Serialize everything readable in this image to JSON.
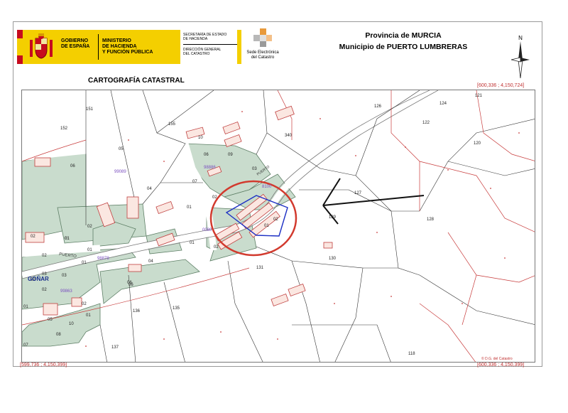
{
  "header": {
    "gobierno_line1": "GOBIERNO",
    "gobierno_line2": "DE ESPAÑA",
    "ministerio_line1": "MINISTERIO",
    "ministerio_line2": "DE HACIENDA",
    "ministerio_line3": "Y FUNCIÓN PÚBLICA",
    "secretaria_line1": "SECRETARÍA DE ESTADO",
    "secretaria_line2": "DE HACIENDA",
    "direccion_line1": "DIRECCIÓN GENERAL",
    "direccion_line2": "DEL CATASTRO",
    "sede_line1": "Sede Electrónica",
    "sede_line2": "del Catastro",
    "provincia": "Provincia de MURCIA",
    "municipio": "Municipio de PUERTO LUMBRERAS",
    "north_label": "N"
  },
  "map": {
    "title": "CARTOGRAFÍA CATASTRAL",
    "coord_top_right": "[600,336 ; 4,150,724]",
    "coord_bottom_left": "[599,736 ; 4,150,399]",
    "coord_bottom_right": "[600,336 ; 4,150,399]",
    "copyright": "© D.G. del Catastro",
    "place_name": "GOÑAR",
    "street_labels": [
      "PUERTO",
      "PUERTO"
    ],
    "block_codes": [
      "99089",
      "98886",
      "99863",
      "98878",
      "0080",
      "8100"
    ],
    "parcels": [
      "151",
      "152",
      "155",
      "05",
      "10",
      "06",
      "09",
      "340",
      "126",
      "124",
      "122",
      "121",
      "120",
      "06",
      "04",
      "07",
      "03",
      "02",
      "01",
      "02",
      "01",
      "127",
      "128",
      "129",
      "02",
      "01",
      "02",
      "01",
      "01",
      "03",
      "02",
      "04",
      "06",
      "130",
      "131",
      "136",
      "135",
      "137",
      "118",
      "02",
      "01",
      "05",
      "10",
      "08",
      "07",
      "06",
      "03",
      "02",
      "01",
      "02",
      "01",
      "02",
      "01"
    ],
    "colors": {
      "block_fill": "#c9dccd",
      "line_red": "#c83c3c",
      "street": "#ffffff",
      "annotation_circle": "#d23a2e",
      "arrow": "#111111",
      "selected_parcel": "#1c2fc4"
    }
  }
}
